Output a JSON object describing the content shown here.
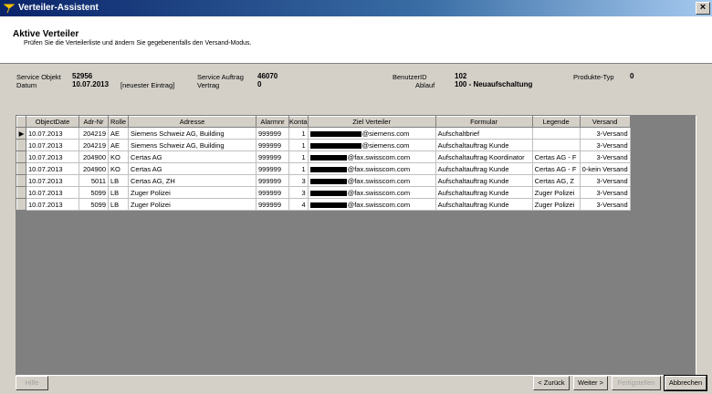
{
  "window": {
    "title": "Verteiler-Assistent",
    "close": "×"
  },
  "header": {
    "title": "Aktive Verteiler",
    "subtitle": "Prüfen Sie die Verteilerliste und ändern Sie gegebenenfalls den Versand-Modus."
  },
  "info": {
    "service_objekt_label": "Service Objekt",
    "service_objekt_value": "52956",
    "datum_label": "Datum",
    "datum_value": "10.07.2013",
    "datum_note": "[neuester Eintrag]",
    "service_auftrag_label": "Service Auftrag",
    "service_auftrag_value": "46070",
    "vertrag_label": "Vertrag",
    "vertrag_value": "0",
    "benutzer_label": "BenutzerID",
    "benutzer_value": "102",
    "ablauf_label": "Ablauf",
    "ablauf_value": "100 - Neuaufschaltung",
    "produkte_label": "Produkte-Typ",
    "produkte_value": "0"
  },
  "table": {
    "columns": [
      "ObjectDate",
      "Adr-Nr",
      "Rolle",
      "Adresse",
      "Alarmnr",
      "Konta",
      "Ziel Verteiler",
      "Formular",
      "Legende",
      "Versand"
    ],
    "rows": [
      {
        "date": "10.07.2013",
        "adr": "204219",
        "rolle": "AE",
        "adresse": "Siemens Schweiz AG, Building",
        "alarm": "999999",
        "konta": "1",
        "ziel": "@siemens.com",
        "formular": "Aufschaltbrief",
        "legende": "",
        "versand": "3-Versand"
      },
      {
        "date": "10.07.2013",
        "adr": "204219",
        "rolle": "AE",
        "adresse": "Siemens Schweiz AG, Building",
        "alarm": "999999",
        "konta": "1",
        "ziel": "@siemens.com",
        "formular": "Aufschaltauftrag Kunde",
        "legende": "",
        "versand": "3-Versand"
      },
      {
        "date": "10.07.2013",
        "adr": "204900",
        "rolle": "KO",
        "adresse": "Certas AG",
        "alarm": "999999",
        "konta": "1",
        "ziel": "@fax.swisscom.com",
        "formular": "Aufschaltauftrag Koordinator",
        "legende": "Certas AG - F",
        "versand": "3-Versand"
      },
      {
        "date": "10.07.2013",
        "adr": "204900",
        "rolle": "KO",
        "adresse": "Certas AG",
        "alarm": "999999",
        "konta": "1",
        "ziel": "@fax.swisscom.com",
        "formular": "Aufschaltauftrag Kunde",
        "legende": "Certas AG - F",
        "versand": "0-kein Versand"
      },
      {
        "date": "10.07.2013",
        "adr": "5011",
        "rolle": "LB",
        "adresse": "Certas AG, ZH",
        "alarm": "999999",
        "konta": "3",
        "ziel": "@fax.swisscom.com",
        "formular": "Aufschaltauftrag Kunde",
        "legende": "Certas AG, Z",
        "versand": "3-Versand"
      },
      {
        "date": "10.07.2013",
        "adr": "5099",
        "rolle": "LB",
        "adresse": "Zuger Polizei",
        "alarm": "999999",
        "konta": "3",
        "ziel": "@fax.swisscom.com",
        "formular": "Aufschaltauftrag Kunde",
        "legende": "Zuger Polizei",
        "versand": "3-Versand"
      },
      {
        "date": "10.07.2013",
        "adr": "5099",
        "rolle": "LB",
        "adresse": "Zuger Polizei",
        "alarm": "999999",
        "konta": "4",
        "ziel": "@fax.swisscom.com",
        "formular": "Aufschaltauftrag Kunde",
        "legende": "Zuger Polizei",
        "versand": "3-Versand"
      }
    ]
  },
  "buttons": {
    "help": "Hilfe",
    "back": "< Zurück",
    "next": "Weiter >",
    "finish": "Fertigstellen",
    "cancel": "Abbrechen"
  }
}
